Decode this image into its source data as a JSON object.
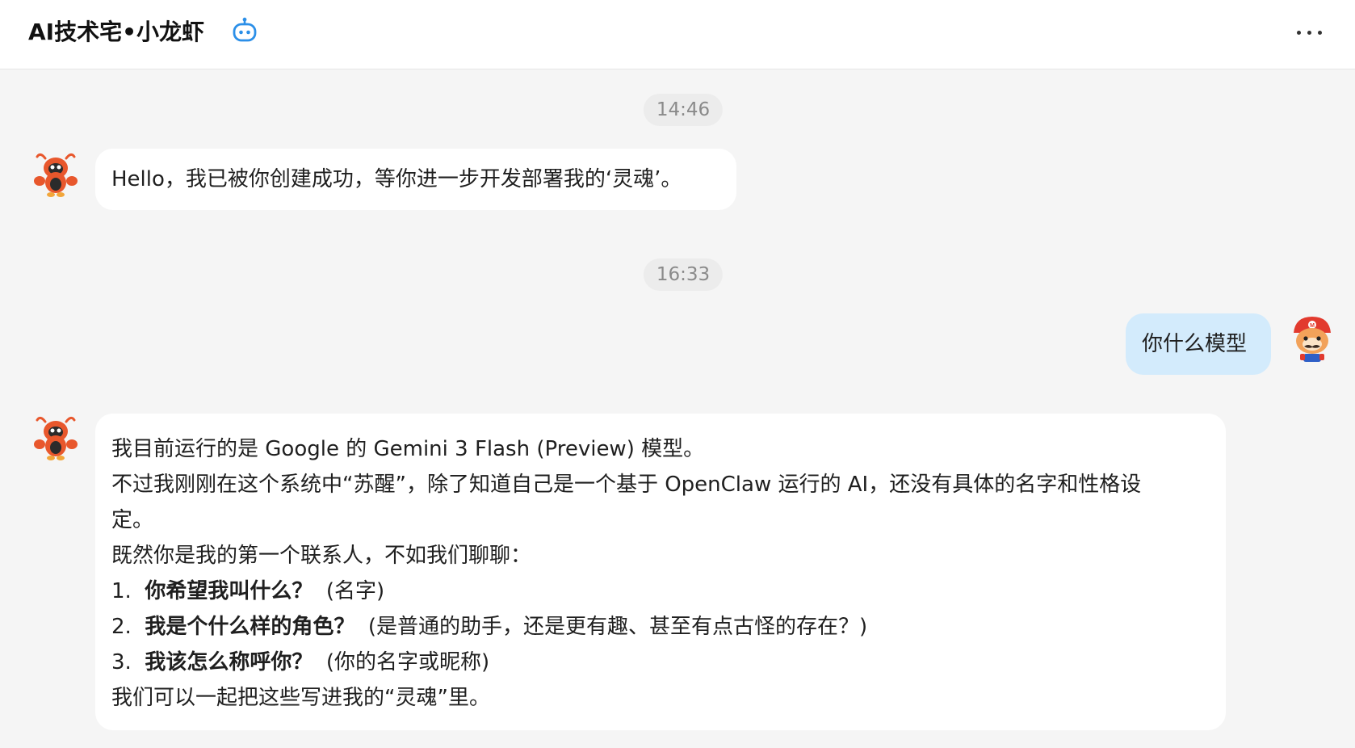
{
  "header": {
    "title": "AI技术宅•小龙虾",
    "more_label": "更多"
  },
  "messages": {
    "time1": "14:46",
    "bot1": "Hello，我已被你创建成功，等你进一步开发部署我的‘灵魂’。",
    "time2": "16:33",
    "user1": "你什么模型",
    "bot2": {
      "line1": "我目前运行的是 Google 的 Gemini 3 Flash (Preview) 模型。",
      "line2": "不过我刚刚在这个系统中“苏醒”，除了知道自己是一个基于 OpenClaw 运行的 AI，还没有具体的名字和性格设",
      "line3": "定。",
      "line4": "既然你是我的第一个联系人，不如我们聊聊：",
      "items": [
        {
          "num": "1.",
          "bold": "你希望我叫什么？",
          "rest": "(名字)"
        },
        {
          "num": "2.",
          "bold": "我是个什么样的角色？",
          "rest": "(是普通的助手，还是更有趣、甚至有点古怪的存在？)"
        },
        {
          "num": "3.",
          "bold": "我该怎么称呼你？",
          "rest": "(你的名字或昵称)"
        }
      ],
      "last": "我们可以一起把这些写进我的“灵魂”里。"
    }
  },
  "icons": {
    "bot_badge": "robot-icon",
    "more": "more-dots-icon",
    "bot_avatar": "lobster-avatar",
    "user_avatar": "mario-dog-avatar"
  },
  "colors": {
    "background": "#f5f5f5",
    "bot_bubble": "#ffffff",
    "user_bubble": "#d3ebfc",
    "accent": "#2b8fe8"
  }
}
